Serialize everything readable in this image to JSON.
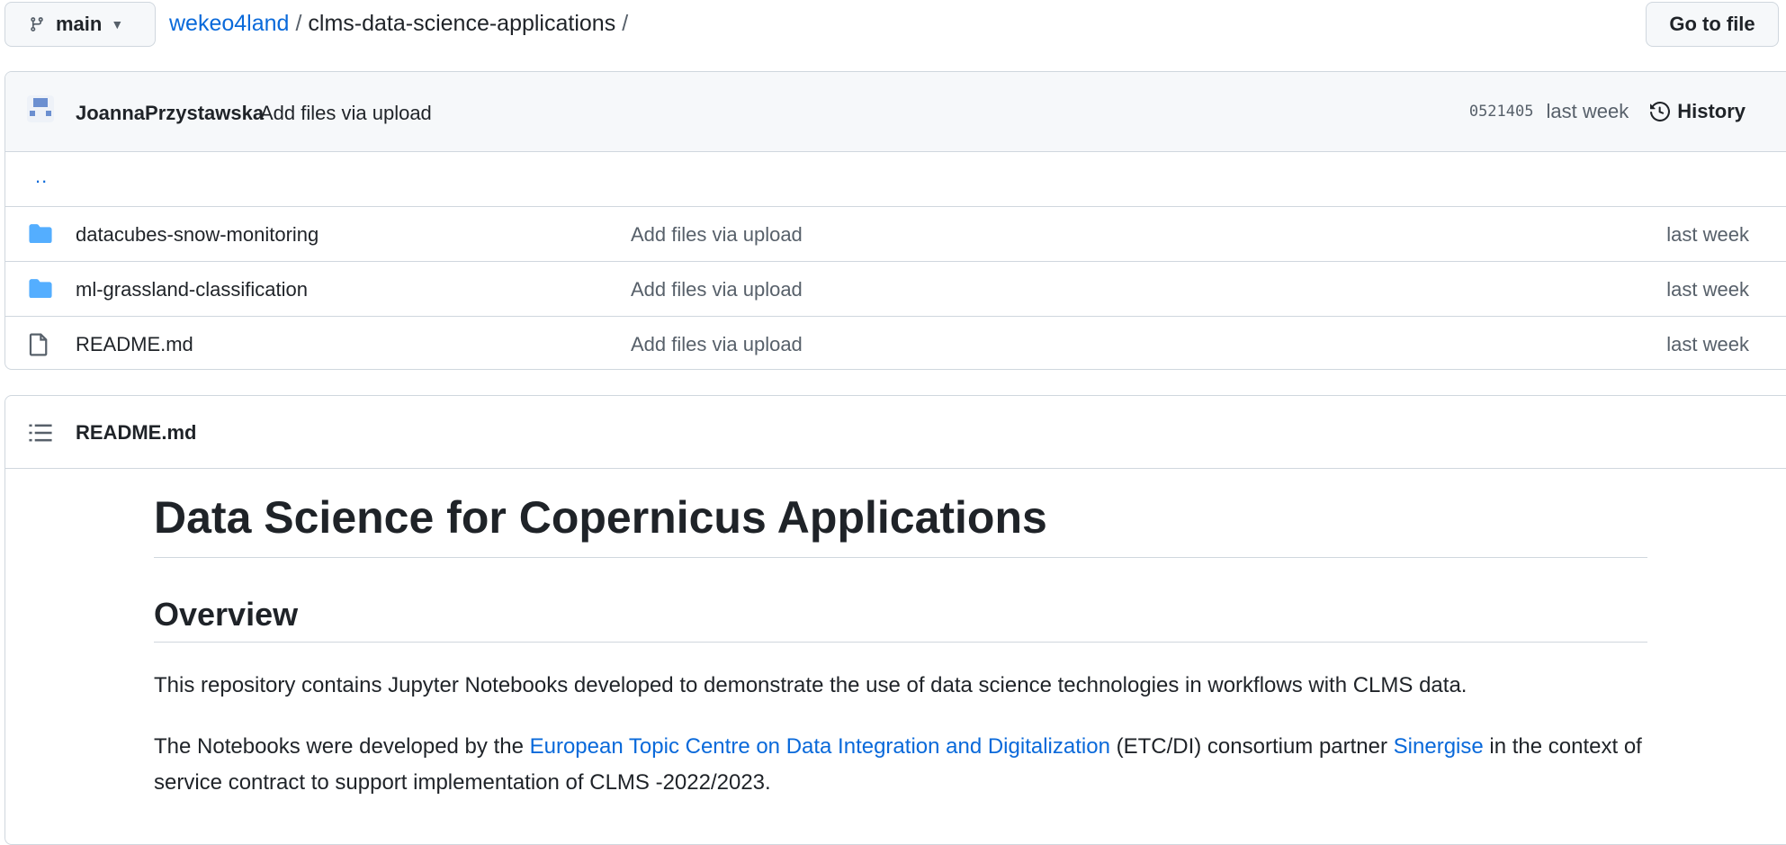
{
  "topbar": {
    "branch": "main",
    "breadcrumb": {
      "owner": "wekeo4land",
      "sep1": "/",
      "repo": "clms-data-science-applications",
      "sep2": "/"
    },
    "go_to_file": "Go to file"
  },
  "commit": {
    "author": "JoannaPrzystawska",
    "message": "Add files via upload",
    "sha": "0521405",
    "time": "last week",
    "history_label": "History"
  },
  "parent_dir": "..",
  "files": [
    {
      "name": "datacubes-snow-monitoring",
      "type": "folder",
      "message": "Add files via upload",
      "date": "last week"
    },
    {
      "name": "ml-grassland-classification",
      "type": "folder",
      "message": "Add files via upload",
      "date": "last week"
    },
    {
      "name": "README.md",
      "type": "file",
      "message": "Add files via upload",
      "date": "last week"
    }
  ],
  "readme": {
    "filename": "README.md",
    "h1": "Data Science for Copernicus Applications",
    "h2": "Overview",
    "p1": "This repository contains Jupyter Notebooks developed to demonstrate the use of data science technologies in workflows with CLMS data.",
    "p2_part1": "The Notebooks were developed by the ",
    "p2_link1": "European Topic Centre on Data Integration and Digitalization",
    "p2_part2": " (ETC/DI) consortium partner ",
    "p2_link2": "Sinergise",
    "p2_part3": " in the context of service contract to support implementation of CLMS -2022/2023."
  },
  "colors": {
    "accent": "#0969da",
    "folder": "#54aeff",
    "muted": "#57606a",
    "border": "#d0d7de"
  }
}
